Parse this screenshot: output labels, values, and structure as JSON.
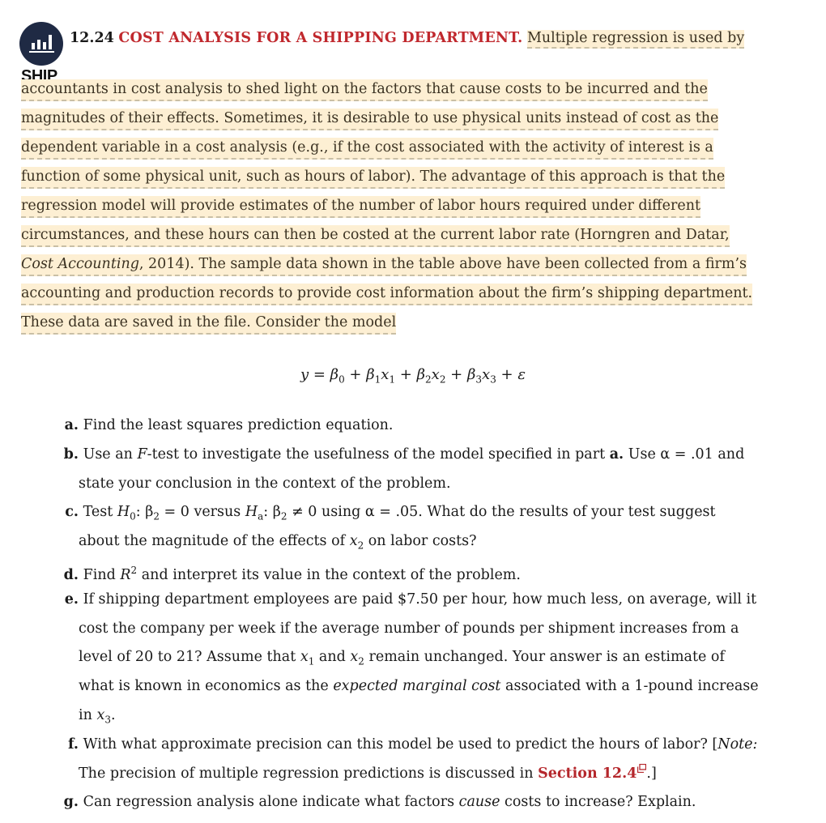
{
  "badge": {
    "icon": "bar-chart-icon",
    "label": "SHIP",
    "icon_bg_color": "#1f2a44"
  },
  "exercise": {
    "number": "12.24",
    "title": "COST ANALYSIS FOR A SHIPPING DEPARTMENT.",
    "title_color": "#c0282d",
    "highlight_color": "#fdefd3",
    "intro_first": "Multiple regression is used by",
    "intro_lines": [
      "accountants in cost analysis to shed light on the factors that cause costs to be incurred and the",
      "magnitudes of their effects. Sometimes, it is desirable to use physical units instead of cost as the",
      "dependent variable in a cost analysis (e.g., if the cost associated with the activity of interest is a",
      "function of some physical unit, such as hours of labor). The advantage of this approach is that the",
      "regression model will provide estimates of the number of labor hours required under different",
      "circumstances, and these hours can then be costed at the current labor rate (Horngren and Datar,"
    ],
    "citation_italic": "Cost Accounting",
    "citation_rest": ", 2014). The sample data shown in the table above have been collected from a firm’s",
    "intro_lines_after": [
      "accounting and production records to provide cost information about the firm’s shipping department.",
      "These data are saved in the file. Consider the model"
    ]
  },
  "model_equation": "y = β0 + β1x1 + β2x2 + β3x3 + ε",
  "parts": {
    "a": {
      "letter": "a.",
      "text": "Find the least squares prediction equation."
    },
    "b": {
      "letter": "b.",
      "t1": "Use an ",
      "f": "F",
      "t2": "-test to investigate the usefulness of the model specified in part ",
      "ref": "a.",
      "t3": " Use α = .01 and",
      "line2": "state your conclusion in the context of the problem."
    },
    "c": {
      "letter": "c.",
      "t1": "Test ",
      "t2": ": β",
      "t3": " = 0 versus ",
      "t4": ": β",
      "t5": " ≠ 0 using α = .05. What do the results of your test suggest",
      "line2a": "about the magnitude of the effects of ",
      "line2b": " on labor costs?"
    },
    "d": {
      "letter": "d.",
      "t1": "Find ",
      "t2": " and interpret its value in the context of the problem."
    },
    "e": {
      "letter": "e.",
      "line1": "If shipping department employees are paid $7.50 per hour, how much less, on average, will it",
      "line2": "cost the company per week if the average number of pounds per shipment increases from a",
      "line3a": "level of 20 to 21? Assume that ",
      "line3b": " and ",
      "line3c": " remain unchanged. Your answer is an estimate of",
      "line4a": "what is known in economics as the ",
      "line4_italic": "expected marginal cost",
      "line4b": " associated with a 1-pound increase",
      "line5": "in "
    },
    "f": {
      "letter": "f.",
      "line1a": "With what approximate precision can this model be used to predict the hours of labor? [",
      "note": "Note:",
      "line2a": "The precision of multiple regression predictions is discussed in ",
      "link": "Section 12.4",
      "line2b": ".]"
    },
    "g": {
      "letter": "g.",
      "t1": "Can regression analysis alone indicate what factors ",
      "italic": "cause",
      "t2": " costs to increase? Explain."
    }
  }
}
